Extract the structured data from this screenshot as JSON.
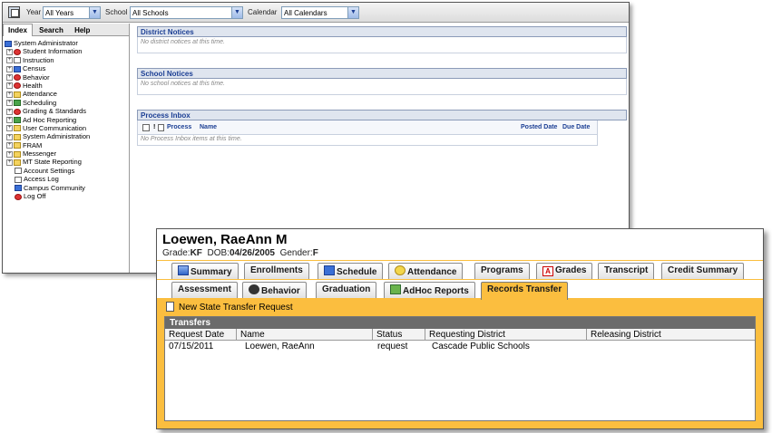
{
  "portal": {
    "topbar": {
      "year_label": "Year",
      "year_value": "All Years",
      "school_label": "School",
      "school_value": "All Schools",
      "calendar_label": "Calendar",
      "calendar_value": "All Calendars"
    },
    "nav_tabs": [
      "Index",
      "Search",
      "Help"
    ],
    "tree": [
      "System Administrator",
      "Student Information",
      "Instruction",
      "Census",
      "Behavior",
      "Health",
      "Attendance",
      "Scheduling",
      "Grading & Standards",
      "Ad Hoc Reporting",
      "User Communication",
      "System Administration",
      "FRAM",
      "Messenger",
      "MT State Reporting",
      "Account Settings",
      "Access Log",
      "Campus Community",
      "Log Off"
    ],
    "district_notices": {
      "title": "District Notices",
      "empty": "No district notices at this time."
    },
    "school_notices": {
      "title": "School Notices",
      "empty": "No school notices at this time."
    },
    "process_inbox": {
      "title": "Process Inbox",
      "col_flag": "!",
      "col_process": "Process",
      "col_name": "Name",
      "col_posted": "Posted Date",
      "col_due": "Due Date",
      "empty": "No Process Inbox items at this time."
    }
  },
  "student": {
    "name": "Loewen, RaeAnn M",
    "grade_label": "Grade:",
    "grade": "KF",
    "dob_label": "DOB:",
    "dob": "04/26/2005",
    "gender_label": "Gender:",
    "gender": "F",
    "tabs_row1": [
      "Summary",
      "Enrollments",
      "Schedule",
      "Attendance",
      "Programs",
      "Grades",
      "Transcript",
      "Credit Summary"
    ],
    "tabs_row2": [
      "Assessment",
      "Behavior",
      "Graduation",
      "AdHoc Reports",
      "Records Transfer"
    ],
    "new_request": "New State Transfer Request",
    "transfers": {
      "title": "Transfers",
      "columns": [
        "Request Date",
        "Name",
        "Status",
        "Requesting District",
        "Releasing District"
      ],
      "rows": [
        [
          "07/15/2011",
          "Loewen, RaeAnn",
          "request",
          "Cascade Public Schools",
          ""
        ]
      ]
    }
  }
}
